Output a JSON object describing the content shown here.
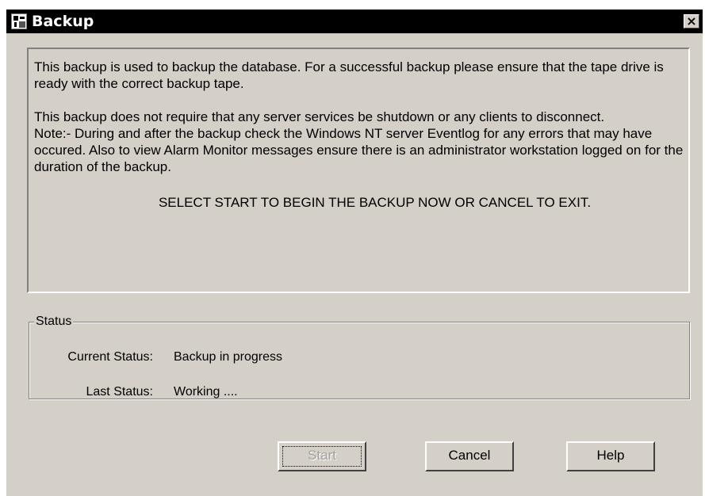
{
  "window": {
    "title": "Backup",
    "close_glyph": "×",
    "icon": "backup-app-icon"
  },
  "info": {
    "para1": "This backup is used to backup the database. For a successful backup please ensure that the tape drive is ready with the correct backup tape.",
    "para2": "This backup does not require that any server services be shutdown or any clients to disconnect.",
    "para3": "Note:- During and after the backup check the Windows NT server Eventlog for any errors that may have occured. Also to view Alarm Monitor messages ensure there is an administrator workstation logged on for the duration of the backup.",
    "instruction": "SELECT START TO BEGIN THE BACKUP NOW OR CANCEL TO EXIT."
  },
  "status": {
    "legend": "Status",
    "current_label": "Current Status:",
    "current_value": "Backup in progress",
    "last_label": "Last Status:",
    "last_value": "Working ...."
  },
  "buttons": {
    "start_label": "Start",
    "cancel_label": "Cancel",
    "help_label": "Help"
  },
  "colors": {
    "face": "#d4d0c8",
    "titlebar": "#000000"
  }
}
